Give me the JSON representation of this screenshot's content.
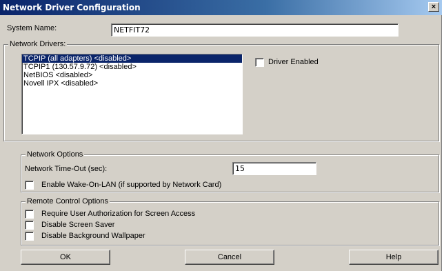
{
  "window": {
    "title": "Network Driver Configuration",
    "close_glyph": "×"
  },
  "system": {
    "label": "System Name:",
    "value": "NETFIT72"
  },
  "drivers": {
    "legend": "Network Drivers:",
    "items": [
      {
        "label": "TCPIP (all adapters) <disabled>",
        "selected": true
      },
      {
        "label": "TCPIP1 (130.57.9.72) <disabled>",
        "selected": false
      },
      {
        "label": "NetBIOS <disabled>",
        "selected": false
      },
      {
        "label": "Novell IPX <disabled>",
        "selected": false
      }
    ],
    "enabled_label": "Driver Enabled",
    "enabled_checked": false
  },
  "network_options": {
    "legend": "Network Options",
    "timeout_label": "Network Time-Out (sec):",
    "timeout_value": "15",
    "wol_label": "Enable Wake-On-LAN (if supported by Network Card)",
    "wol_checked": false
  },
  "remote_control": {
    "legend": "Remote Control Options",
    "options": [
      {
        "label": "Require User Authorization for Screen Access",
        "checked": false
      },
      {
        "label": "Disable Screen Saver",
        "checked": false
      },
      {
        "label": "Disable Background Wallpaper",
        "checked": false
      }
    ]
  },
  "buttons": {
    "ok": "OK",
    "cancel": "Cancel",
    "help": "Help"
  }
}
